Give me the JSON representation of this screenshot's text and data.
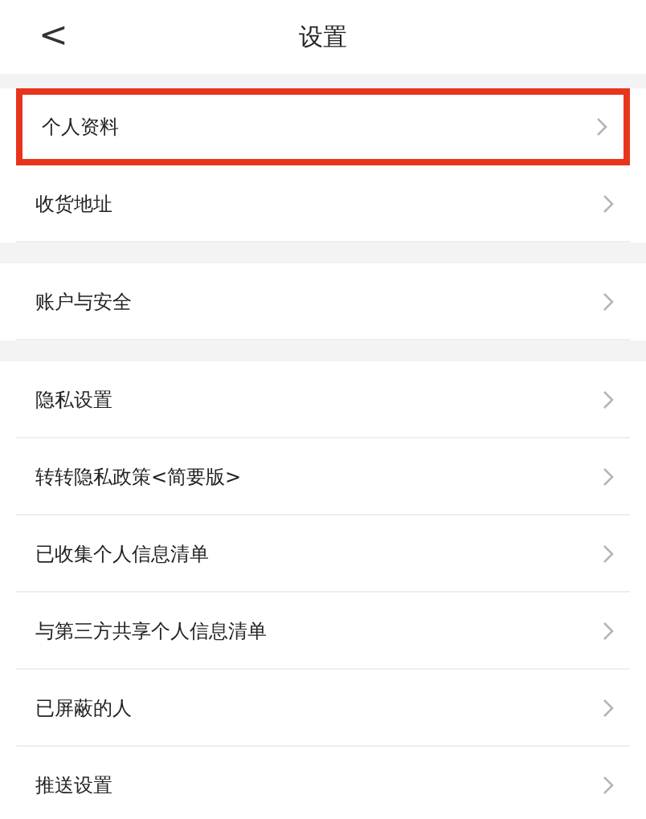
{
  "header": {
    "back": "<",
    "title": "设置"
  },
  "sections": [
    {
      "items": [
        {
          "label": "个人资料",
          "highlighted": true
        },
        {
          "label": "收货地址",
          "highlighted": false
        }
      ]
    },
    {
      "items": [
        {
          "label": "账户与安全",
          "highlighted": false
        }
      ]
    },
    {
      "items": [
        {
          "label": "隐私设置",
          "highlighted": false
        },
        {
          "label": "转转隐私政策<简要版>",
          "highlighted": false
        },
        {
          "label": "已收集个人信息清单",
          "highlighted": false
        },
        {
          "label": "与第三方共享个人信息清单",
          "highlighted": false
        },
        {
          "label": "已屏蔽的人",
          "highlighted": false
        },
        {
          "label": "推送设置",
          "highlighted": false
        }
      ]
    }
  ]
}
